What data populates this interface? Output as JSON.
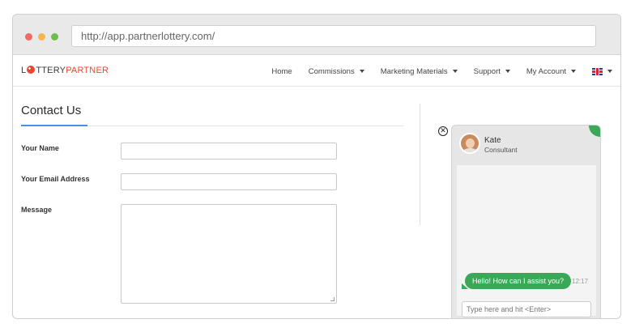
{
  "browser": {
    "url": "http://app.partnerlottery.com/"
  },
  "colors": {
    "close_dot": "#f46a62",
    "minimize_dot": "#f4b64d",
    "maximize_dot": "#6abf4b",
    "brand_accent": "#e8472f",
    "link_accent": "#4a90e2",
    "chat_green": "#3aa856"
  },
  "logo": {
    "part1": "L",
    "part2": "TTERY",
    "part3": "PARTNER"
  },
  "nav": {
    "items": [
      {
        "label": "Home",
        "dropdown": false
      },
      {
        "label": "Commissions",
        "dropdown": true
      },
      {
        "label": "Marketing Materials",
        "dropdown": true
      },
      {
        "label": "Support",
        "dropdown": true
      },
      {
        "label": "My Account",
        "dropdown": true
      }
    ],
    "language_icon": "uk-flag-icon"
  },
  "page": {
    "title": "Contact Us"
  },
  "form": {
    "name_label": "Your Name",
    "name_value": "",
    "email_label": "Your Email Address",
    "email_value": "",
    "message_label": "Message",
    "message_value": ""
  },
  "chat": {
    "agent_name": "Kate",
    "agent_role": "Consultant",
    "close_icon": "circle-x-icon",
    "messages": [
      {
        "text": "Hello! How can I assist you?",
        "time": "12:17"
      }
    ],
    "input_placeholder": "Type here and hit <Enter>"
  }
}
